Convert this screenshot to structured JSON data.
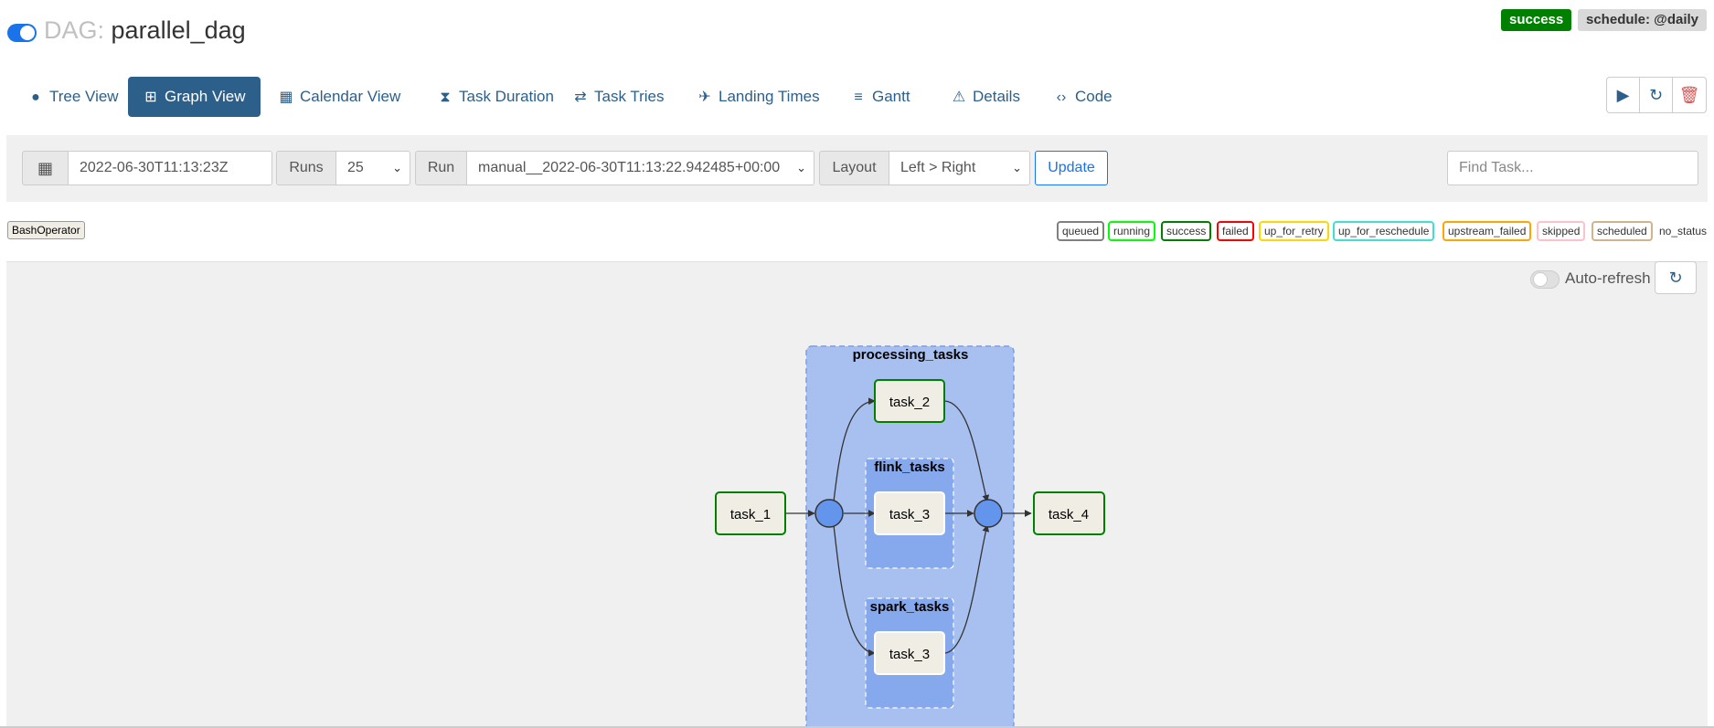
{
  "header": {
    "dag_prefix": "DAG:",
    "dag_name": "parallel_dag",
    "status_badge": "success",
    "schedule_badge": "schedule: @daily"
  },
  "nav": {
    "tabs": [
      {
        "label": "Tree View",
        "icon": "tree-icon"
      },
      {
        "label": "Graph View",
        "icon": "graph-icon",
        "active": true
      },
      {
        "label": "Calendar View",
        "icon": "calendar-icon"
      },
      {
        "label": "Task Duration",
        "icon": "hourglass-icon"
      },
      {
        "label": "Task Tries",
        "icon": "retry-icon"
      },
      {
        "label": "Landing Times",
        "icon": "plane-landing-icon"
      },
      {
        "label": "Gantt",
        "icon": "gantt-icon"
      },
      {
        "label": "Details",
        "icon": "warning-icon"
      },
      {
        "label": "Code",
        "icon": "code-icon"
      }
    ]
  },
  "actions": {
    "trigger_icon": "play-icon",
    "refresh_icon": "refresh-icon",
    "delete_icon": "trash-icon"
  },
  "filters": {
    "date_value": "2022-06-30T11:13:23Z",
    "runs_label": "Runs",
    "runs_value": "25",
    "run_label": "Run",
    "run_value": "manual__2022-06-30T11:13:22.942485+00:00",
    "layout_label": "Layout",
    "layout_value": "Left > Right",
    "update_label": "Update",
    "find_task_placeholder": "Find Task..."
  },
  "operator_tag": "BashOperator",
  "legend": [
    {
      "label": "queued",
      "color": "#808080"
    },
    {
      "label": "running",
      "color": "#00ff00"
    },
    {
      "label": "success",
      "color": "#008000"
    },
    {
      "label": "failed",
      "color": "#ff0000"
    },
    {
      "label": "up_for_retry",
      "color": "#ffd700"
    },
    {
      "label": "up_for_reschedule",
      "color": "#40e0d0"
    },
    {
      "label": "upstream_failed",
      "color": "#ffa500"
    },
    {
      "label": "skipped",
      "color": "#ffc0cb"
    },
    {
      "label": "scheduled",
      "color": "#d2b48c"
    },
    {
      "label": "no_status",
      "color": ""
    }
  ],
  "graph_controls": {
    "auto_refresh_label": "Auto-refresh"
  },
  "graph": {
    "groups": {
      "processing": "processing_tasks",
      "flink": "flink_tasks",
      "spark": "spark_tasks"
    },
    "tasks": {
      "task_1": "task_1",
      "task_2": "task_2",
      "flink_task_3": "task_3",
      "spark_task_3": "task_3",
      "task_4": "task_4"
    }
  },
  "colors": {
    "primary": "#2d5f8b",
    "success": "#008000",
    "group_outer": "#a8c0f0",
    "group_inner": "#86a8ec",
    "join_node": "#6495ed",
    "task_fill": "#f0ede4"
  }
}
